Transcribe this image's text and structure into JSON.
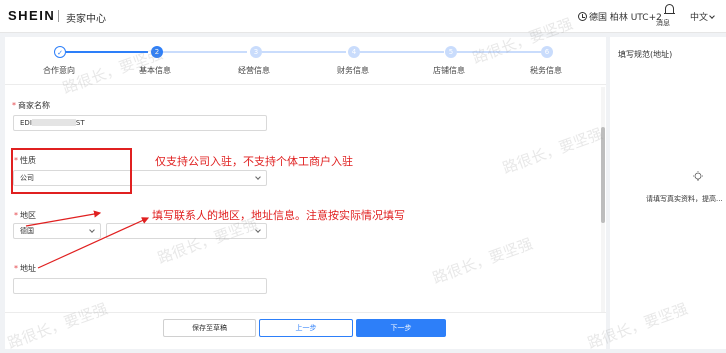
{
  "header": {
    "logo": "SHEIN",
    "center_title": "卖家中心",
    "timezone": "德国 柏林 UTC+2",
    "notifications_label": "消息",
    "language": "中文"
  },
  "steps": [
    {
      "number": "✓",
      "label": "合作意向",
      "state": "done"
    },
    {
      "number": "2",
      "label": "基本信息",
      "state": "current"
    },
    {
      "number": "3",
      "label": "经营信息",
      "state": "todo"
    },
    {
      "number": "4",
      "label": "财务信息",
      "state": "todo"
    },
    {
      "number": "5",
      "label": "店铺信息",
      "state": "todo"
    },
    {
      "number": "6",
      "label": "税务信息",
      "state": "todo"
    }
  ],
  "form": {
    "merchant_name": {
      "label": "商家名称",
      "value_prefix": "EDI",
      "value_suffix": "ST"
    },
    "nature": {
      "label": "性质",
      "value": "公司"
    },
    "region": {
      "label": "地区",
      "value": "德国"
    },
    "address": {
      "label": "地址",
      "value": ""
    }
  },
  "annotations": {
    "nature_note": "仅支持公司入驻，不支持个体工商户入驻",
    "region_note": "填写联系人的地区，地址信息。注意按实际情况填写"
  },
  "right_panel": {
    "title": "填写规范(地址)",
    "tip": "请填写真实资料，提高..."
  },
  "footer": {
    "save_draft": "保存至草稿",
    "prev": "上一步",
    "next": "下一步"
  },
  "watermark": {
    "text": "路很长，要坚强"
  },
  "colors": {
    "primary": "#2d7ff9",
    "annotation": "#e02020",
    "required": "#e5484d"
  }
}
